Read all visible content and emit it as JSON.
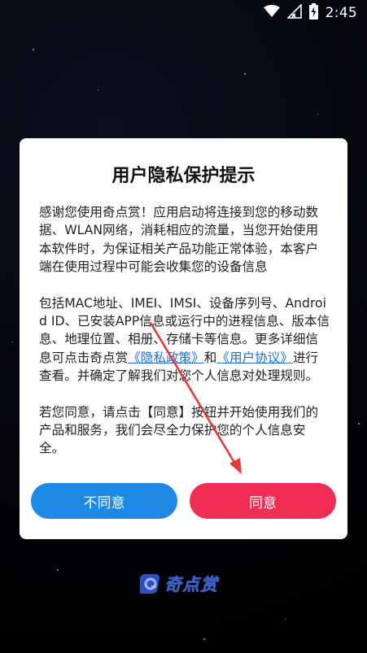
{
  "status_bar": {
    "time": "2:45",
    "icons": [
      "wifi-icon",
      "cellular-signal-icon",
      "battery-charging-icon"
    ]
  },
  "dialog": {
    "title": "用户隐私保护提示",
    "paragraph1": "感谢您使用奇点赏！应用启动将连接到您的移动数据、WLAN网络，消耗相应的流量，当您开始使用本软件时，为保证相关产品功能正常体验，本客户端在使用过程中可能会收集您的设备信息",
    "paragraph2_before": "包括MAC地址、IMEI、IMSI、设备序列号、Android ID、已安装APP信息或运行中的进程信息、版本信息、地理位置、相册、存储卡等信息。更多详细信息可点击奇点赏",
    "privacy_policy_link": "《隐私政策》",
    "paragraph2_and": "和",
    "user_agreement_link": "《用户协议》",
    "paragraph2_after": "进行查看。并确定了解我们对您个人信息对处理规则。",
    "paragraph3": "若您同意，请点击【同意】按钮并开始使用我们的产品和服务，我们会尽全力保护您的个人信息安全。",
    "disagree_label": "不同意",
    "agree_label": "同意"
  },
  "logo": {
    "text": "奇点赏"
  },
  "colors": {
    "disagree_button": "#1e88e5",
    "agree_button": "#ef2d55",
    "link": "#1e6fd0",
    "annotation_arrow": "#e53935"
  }
}
